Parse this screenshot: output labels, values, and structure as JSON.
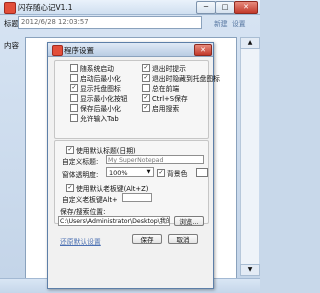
{
  "window": {
    "title": "闪存随心记V1.1",
    "minimize": "─",
    "maximize": "□",
    "close": "✕"
  },
  "main": {
    "title_label": "标题",
    "title_value": "2012/6/28 12:03:57",
    "content_label": "内容",
    "link_new": "新建",
    "link_settings": "设置"
  },
  "dialog": {
    "title": "程序设置",
    "close": "✕",
    "checkboxes": [
      {
        "label": "随系统启动",
        "checked": false
      },
      {
        "label": "退出时提示",
        "checked": true
      },
      {
        "label": "启动后最小化",
        "checked": false
      },
      {
        "label": "退出时隐藏到托盘图标",
        "checked": true
      },
      {
        "label": "显示托盘图标",
        "checked": true
      },
      {
        "label": "总在前端",
        "checked": false
      },
      {
        "label": "显示最小化按钮",
        "checked": false
      },
      {
        "label": "Ctrl+S保存",
        "checked": true
      },
      {
        "label": "保存后最小化",
        "checked": false
      },
      {
        "label": "启用搜索",
        "checked": true
      },
      {
        "label": "允许输入Tab",
        "checked": false
      }
    ],
    "default_title_checkbox": {
      "label": "使用默认标题(日期)",
      "checked": true
    },
    "custom_title_label": "自定义标题:",
    "custom_title_placeholder": "My SuperNotepad",
    "opacity_label": "窗体透明度:",
    "opacity_value": "100%",
    "bgcolor_label": "背景色",
    "default_hotkey_checkbox": {
      "label": "使用默认老板键(Alt+Z)",
      "checked": true
    },
    "custom_hotkey_label": "自定义老板键Alt+",
    "custom_hotkey_value": "",
    "save_path_label": "保存/搜索位置:",
    "save_path_value": "C:\\Users\\Administrator\\Desktop\\我的记",
    "browse_button": "浏览...",
    "restore_link": "还原默认设置",
    "save_button": "保存",
    "cancel_button": "取消"
  }
}
